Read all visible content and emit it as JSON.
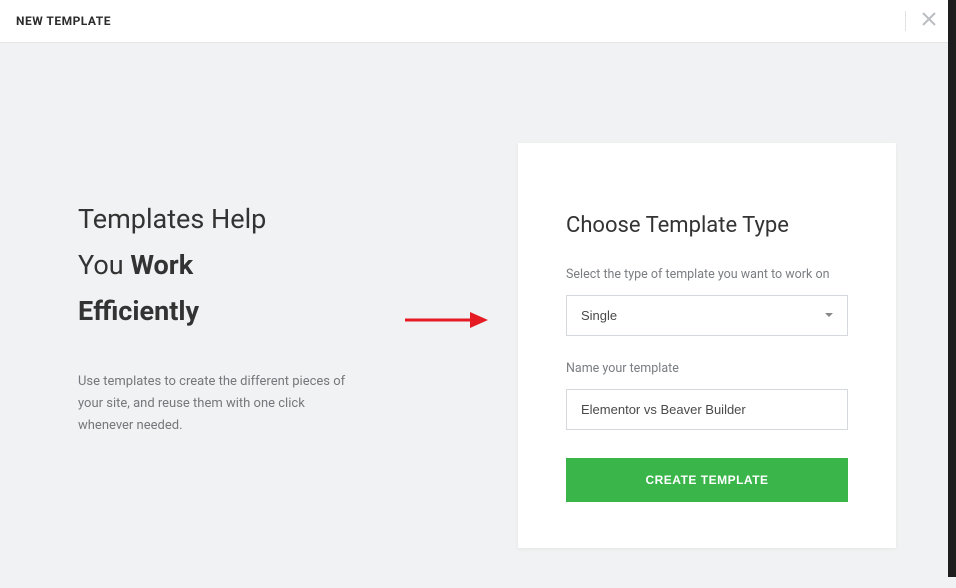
{
  "header": {
    "title": "NEW TEMPLATE"
  },
  "hero": {
    "headline_plain_1": "Templates Help",
    "headline_plain_2": "You ",
    "headline_bold_1": "Work",
    "headline_bold_2": "Efficiently",
    "subtext": "Use templates to create the different pieces of your site, and reuse them with one click whenever needed."
  },
  "form": {
    "title": "Choose Template Type",
    "type_label": "Select the type of template you want to work on",
    "type_value": "Single",
    "name_label": "Name your template",
    "name_value": "Elementor vs Beaver Builder",
    "submit_label": "CREATE TEMPLATE"
  }
}
